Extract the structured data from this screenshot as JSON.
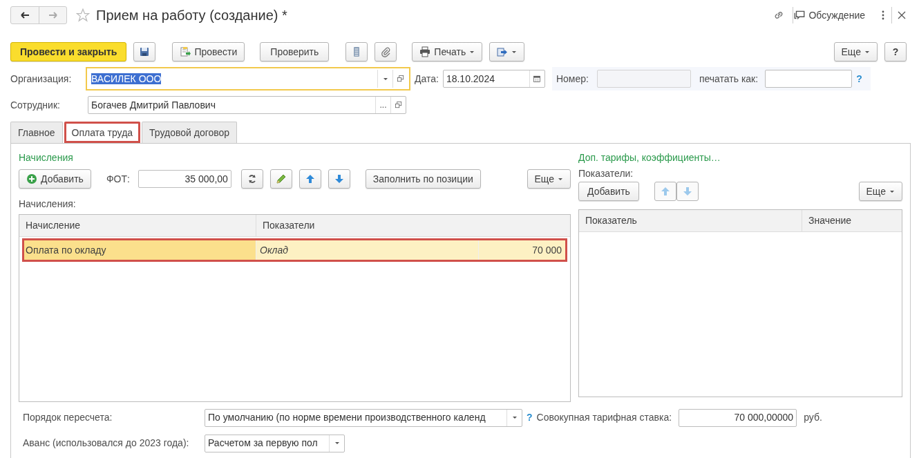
{
  "header": {
    "title": "Прием на работу (создание) *",
    "favorite": false,
    "discussion": "Обсуждение"
  },
  "toolbar": {
    "post_close": "Провести и закрыть",
    "post": "Провести",
    "check": "Проверить",
    "print": "Печать",
    "more": "Еще",
    "help": "?"
  },
  "organization": {
    "label": "Организация:",
    "value": "ВАСИЛЕК ООО",
    "focused": true,
    "text_selected": true
  },
  "date": {
    "label": "Дата:",
    "value": "18.10.2024"
  },
  "number": {
    "label": "Номер:",
    "disabled": true
  },
  "print_as": {
    "label": "печатать как:",
    "help": "?"
  },
  "employee": {
    "label": "Сотрудник:",
    "value": "Богачев Дмитрий Павлович",
    "select_button": "..."
  },
  "tabs": [
    {
      "label": "Главное",
      "selected": false,
      "highlighted": false
    },
    {
      "label": "Оплата труда",
      "selected": true,
      "highlighted": true
    },
    {
      "label": "Трудовой договор",
      "selected": false,
      "highlighted": false
    }
  ],
  "accruals": {
    "title": "Начисления",
    "add": "Добавить",
    "fot_label": "ФОТ:",
    "fot_value": "35 000,00",
    "fill": "Заполнить по позиции",
    "more": "Еще",
    "table_label": "Начисления:",
    "columns": [
      "Начисление",
      "Показатели"
    ],
    "rows": [
      {
        "cells": [
          "Оплата по окладу",
          "Оклад",
          "70 000"
        ],
        "selected": true,
        "highlighted": true
      }
    ]
  },
  "extra": {
    "title": "Доп. тарифы, коэффициенты…",
    "label": "Показатели:",
    "add": "Добавить",
    "more": "Еще",
    "columns": [
      "Показатель",
      "Значение"
    ]
  },
  "bottom": {
    "recalc_label": "Порядок пересчета:",
    "recalc_value": "По умолчанию (по норме времени производственного календ",
    "help": "?",
    "rate_label": "Совокупная тарифная ставка:",
    "rate_value": "70 000,00000",
    "currency": "руб.",
    "advance_label": "Аванс (использовался до 2023 года):",
    "advance_value": "Расчетом за первую пол"
  }
}
